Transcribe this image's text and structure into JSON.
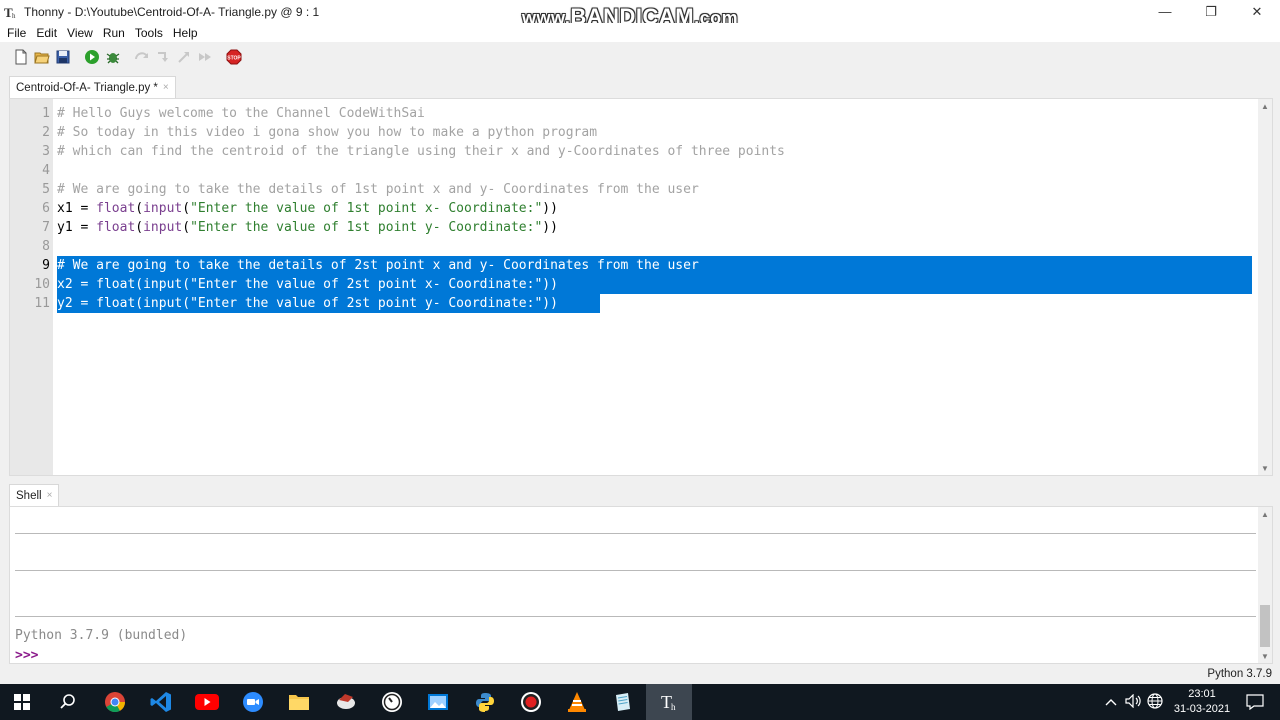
{
  "window": {
    "title": "Thonny  -  D:\\Youtube\\Centroid-Of-A- Triangle.py  @  9 : 1",
    "watermark_prefix": "www.",
    "watermark_main": "BANDICAM",
    "watermark_suffix": ".com",
    "minimize": "—",
    "restore": "❐",
    "close": "✕"
  },
  "menu": [
    "File",
    "Edit",
    "View",
    "Run",
    "Tools",
    "Help"
  ],
  "toolbar_icons": [
    "new-file-icon",
    "open-file-icon",
    "save-icon",
    "run-icon",
    "debug-icon",
    "step-over-icon",
    "step-into-icon",
    "step-out-icon",
    "resume-icon",
    "stop-icon"
  ],
  "editor": {
    "tab_label": "Centroid-Of-A- Triangle.py *",
    "tab_close": "×",
    "line_numbers": [
      "1",
      "2",
      "3",
      "4",
      "5",
      "6",
      "7",
      "8",
      "9",
      "10",
      "11"
    ],
    "lines": [
      [
        {
          "t": "comment",
          "v": "# Hello Guys welcome to the Channel CodeWithSai"
        }
      ],
      [
        {
          "t": "comment",
          "v": "# So today in this video i gona show you how to make a python program"
        }
      ],
      [
        {
          "t": "comment",
          "v": "# which can find the centroid of the triangle using their x and y-Coordinates of three points"
        }
      ],
      [],
      [
        {
          "t": "comment",
          "v": "# We are going to take the details of 1st point x and y- Coordinates from the user"
        }
      ],
      [
        {
          "t": "plain",
          "v": "x1 = "
        },
        {
          "t": "builtin",
          "v": "float"
        },
        {
          "t": "plain",
          "v": "("
        },
        {
          "t": "builtin",
          "v": "input"
        },
        {
          "t": "plain",
          "v": "("
        },
        {
          "t": "str",
          "v": "\"Enter the value of 1st point x- Coordinate:\""
        },
        {
          "t": "plain",
          "v": "))"
        }
      ],
      [
        {
          "t": "plain",
          "v": "y1 = "
        },
        {
          "t": "builtin",
          "v": "float"
        },
        {
          "t": "plain",
          "v": "("
        },
        {
          "t": "builtin",
          "v": "input"
        },
        {
          "t": "plain",
          "v": "("
        },
        {
          "t": "str",
          "v": "\"Enter the value of 1st point y- Coordinate:\""
        },
        {
          "t": "plain",
          "v": "))"
        }
      ],
      [],
      [
        {
          "t": "comment",
          "v": "# We are going to take the details of 2st point x and y- Coordinates from the user"
        }
      ],
      [
        {
          "t": "plain",
          "v": "x2 = "
        },
        {
          "t": "builtin",
          "v": "float"
        },
        {
          "t": "plain",
          "v": "("
        },
        {
          "t": "builtin",
          "v": "input"
        },
        {
          "t": "plain",
          "v": "("
        },
        {
          "t": "str",
          "v": "\"Enter the value of 2st point x- Coordinate:\""
        },
        {
          "t": "plain",
          "v": "))"
        }
      ],
      [
        {
          "t": "plain",
          "v": "y2 = "
        },
        {
          "t": "builtin",
          "v": "float"
        },
        {
          "t": "plain",
          "v": "("
        },
        {
          "t": "builtin",
          "v": "input"
        },
        {
          "t": "plain",
          "v": "("
        },
        {
          "t": "str",
          "v": "\"Enter the value of 2st point y- Coordinate:\""
        },
        {
          "t": "plain",
          "v": "))"
        }
      ]
    ],
    "selected_lines": [
      9,
      10,
      11
    ],
    "current_line": 9
  },
  "shell": {
    "tab_label": "Shell",
    "tab_close": "×",
    "version_text": "Python 3.7.9 (bundled)",
    "prompt": ">>>"
  },
  "status": {
    "interpreter": "Python 3.7.9"
  },
  "taskbar": {
    "icons": [
      "windows-start-icon",
      "search-icon",
      "chrome-icon",
      "vscode-icon",
      "youtube-icon",
      "zoom-icon",
      "file-explorer-icon",
      "app-icon",
      "speedtest-icon",
      "photos-icon",
      "python-icon",
      "bandicam-record-icon",
      "vlc-icon",
      "notepad-icon",
      "thonny-icon"
    ],
    "time": "23:01",
    "date": "31-03-2021"
  },
  "colors": {
    "selection": "#0078d7",
    "comment": "#a3a3a3",
    "builtin": "#7a3f8f",
    "string": "#2f7f2f",
    "prompt": "#8b1a8b"
  }
}
